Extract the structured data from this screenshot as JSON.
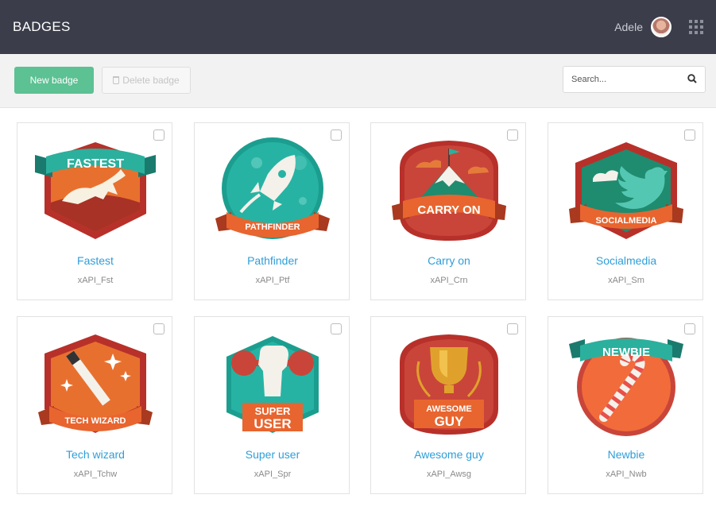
{
  "header": {
    "title": "BADGES",
    "user_name": "Adele"
  },
  "toolbar": {
    "new_label": "New badge",
    "delete_label": "Delete badge",
    "search_placeholder": "Search..."
  },
  "badges": [
    {
      "name": "Fastest",
      "code": "xAPI_Fst",
      "banner": "FASTEST"
    },
    {
      "name": "Pathfinder",
      "code": "xAPI_Ptf",
      "banner": "PATHFINDER"
    },
    {
      "name": "Carry on",
      "code": "xAPI_Crn",
      "banner": "CARRY ON"
    },
    {
      "name": "Socialmedia",
      "code": "xAPI_Sm",
      "banner": "SOCIALMEDIA"
    },
    {
      "name": "Tech wizard",
      "code": "xAPI_Tchw",
      "banner": "TECH WIZARD"
    },
    {
      "name": "Super user",
      "code": "xAPI_Spr",
      "banner": "SUPER",
      "banner2": "USER"
    },
    {
      "name": "Awesome guy",
      "code": "xAPI_Awsg",
      "banner": "AWESOME",
      "banner2": "GUY"
    },
    {
      "name": "Newbie",
      "code": "xAPI_Nwb",
      "banner": "NEWBIE"
    }
  ],
  "colors": {
    "header_bg": "#3b3e4a",
    "accent_green": "#5cc193",
    "link_blue": "#2f9ed8",
    "badge_red": "#c0392b",
    "badge_teal": "#1fa89a",
    "badge_orange": "#f26b3a"
  }
}
